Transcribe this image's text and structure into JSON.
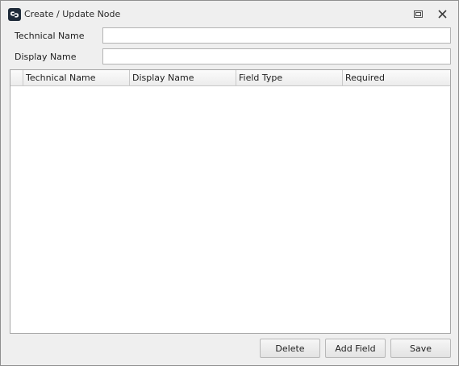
{
  "window": {
    "title": "Create / Update Node",
    "app_icon": "chain-link-icon",
    "controls": [
      "maximize-icon",
      "close-icon"
    ]
  },
  "form": {
    "technical_name_label": "Technical Name",
    "technical_name_value": "",
    "display_name_label": "Display Name",
    "display_name_value": ""
  },
  "grid": {
    "columns": [
      "Technical Name",
      "Display Name",
      "Field Type",
      "Required"
    ],
    "rows": []
  },
  "buttons": {
    "delete": "Delete",
    "add_field": "Add Field",
    "save": "Save"
  },
  "colors": {
    "window_bg": "#efefef",
    "title_icon_bg": "#1f2b3a"
  }
}
